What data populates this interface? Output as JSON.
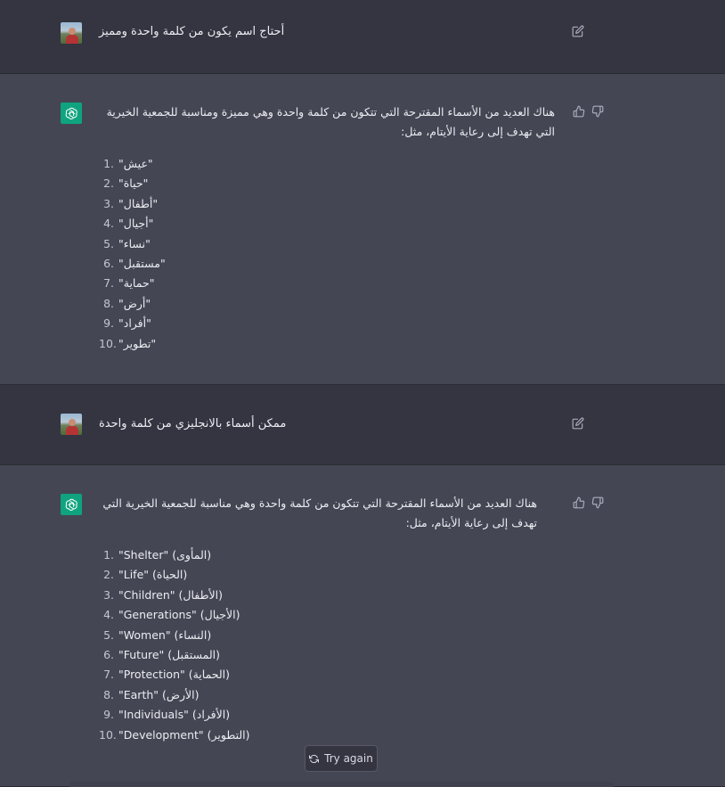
{
  "conversation": [
    {
      "role": "user",
      "text": "أحتاج اسم يكون من كلمة واحدة ومميز"
    },
    {
      "role": "assistant",
      "intro_line1": "هناك العديد من الأسماء المقترحة التي تتكون من كلمة واحدة وهي مميزة ومناسبة للجمعية الخيرية",
      "intro_line2": "التي تهدف إلى رعاية الأيتام، مثل:",
      "items": [
        "\"عيش\"",
        "\"حياة\"",
        "\"أطفال\"",
        "\"أجيال\"",
        "\"نساء\"",
        "\"مستقبل\"",
        "\"حماية\"",
        "\"أرض\"",
        "\"أفراد\"",
        "\"تطوير\""
      ]
    },
    {
      "role": "user",
      "text": "ممكن أسماء بالانجليزي من كلمة واحدة"
    },
    {
      "role": "assistant",
      "intro_line1": "هناك العديد من الأسماء المقترحة التي تتكون من كلمة واحدة وهي مناسبة للجمعية الخيرية التي",
      "intro_line2": "تهدف إلى رعاية الأيتام، مثل:",
      "items": [
        "\"Shelter\" (المأوى)",
        "\"Life\" (الحياة)",
        "\"Children\" (الأطفال)",
        "\"Generations\" (الأجيال)",
        "\"Women\" (النساء)",
        "\"Future\" (المستقبل)",
        "\"Protection\" (الحماية)",
        "\"Earth\" (الأرض)",
        "\"Individuals\" (الأفراد)",
        "\"Development\" (التطوير)"
      ]
    }
  ],
  "list_numbers": [
    "1.",
    "2.",
    "3.",
    "4.",
    "5.",
    "6.",
    "7.",
    "8.",
    "9.",
    "10."
  ],
  "controls": {
    "try_again_label": "Try again"
  },
  "icons": {
    "edit": "edit-icon",
    "thumbs_up": "thumbs-up-icon",
    "thumbs_down": "thumbs-down-icon",
    "refresh": "refresh-icon",
    "openai_logo": "openai-logo-icon"
  },
  "colors": {
    "user_bg": "#343541",
    "assistant_bg": "#444654",
    "gpt_avatar": "#10a37f",
    "text": "#ececf1"
  }
}
